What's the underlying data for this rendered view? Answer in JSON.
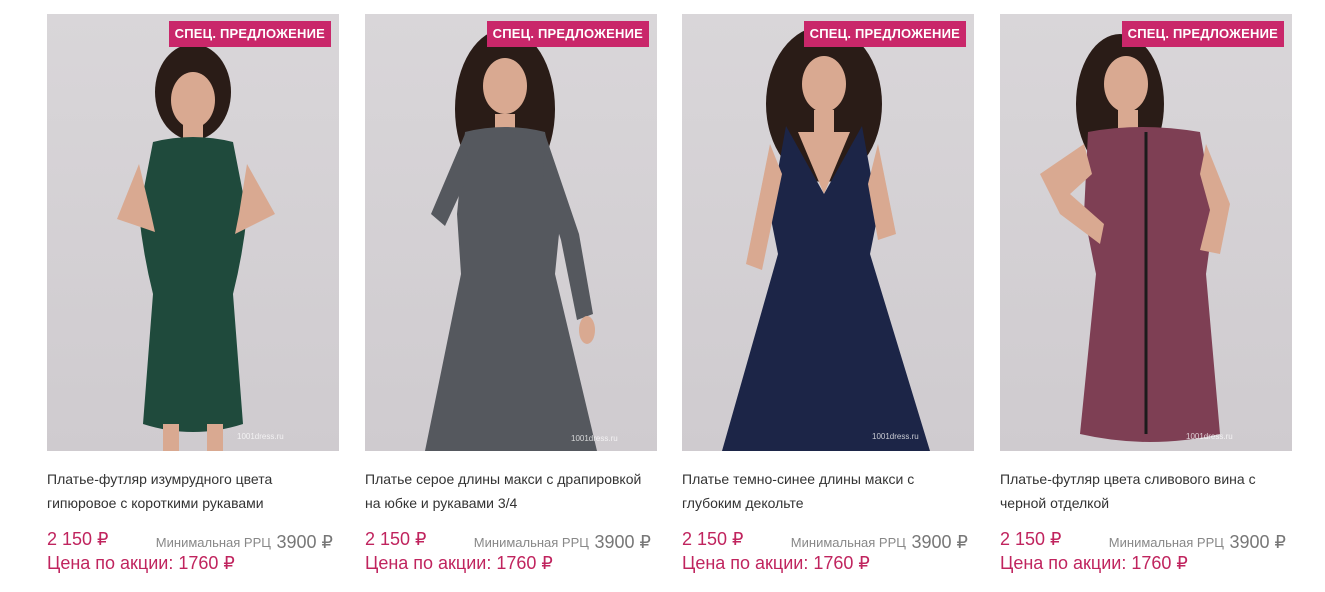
{
  "products": [
    {
      "badge": "СПЕЦ. ПРЕДЛОЖЕНИЕ",
      "title": "Платье-футляр изумрудного цвета гипюровое с короткими рукавами",
      "price": "2 150 ₽",
      "rrc_label": "Минимальная РРЦ",
      "rrc_value": "3900 ₽",
      "promo": "Цена по акции: 1760 ₽",
      "dress_color": "#1f4a3c",
      "watermark": "1001dress.ru"
    },
    {
      "badge": "СПЕЦ. ПРЕДЛОЖЕНИЕ",
      "title": "Платье серое длины макси с драпировкой на юбке и рукавами 3/4",
      "price": "2 150 ₽",
      "rrc_label": "Минимальная РРЦ",
      "rrc_value": "3900 ₽",
      "promo": "Цена по акции: 1760 ₽",
      "dress_color": "#55585e",
      "watermark": "1001dress.ru"
    },
    {
      "badge": "СПЕЦ. ПРЕДЛОЖЕНИЕ",
      "title": "Платье темно-синее длины макси с глубоким декольте",
      "price": "2 150 ₽",
      "rrc_label": "Минимальная РРЦ",
      "rrc_value": "3900 ₽",
      "promo": "Цена по акции: 1760 ₽",
      "dress_color": "#1c2547",
      "watermark": "1001dress.ru"
    },
    {
      "badge": "СПЕЦ. ПРЕДЛОЖЕНИЕ",
      "title": "Платье-футляр цвета сливового вина с черной отделкой",
      "price": "2 150 ₽",
      "rrc_label": "Минимальная РРЦ",
      "rrc_value": "3900 ₽",
      "promo": "Цена по акции: 1760 ₽",
      "dress_color": "#7e3f54",
      "watermark": "1001dress.ru"
    }
  ],
  "colors": {
    "badge": "#c9276a",
    "price": "#c0245e",
    "skin": "#d9a991",
    "hair": "#2a1c17"
  }
}
